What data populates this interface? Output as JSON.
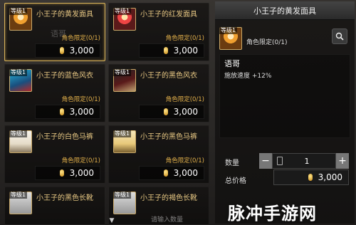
{
  "items": [
    {
      "level": "等级1",
      "name": "小王子的黄发面具",
      "limit": "角色限定(0/1)",
      "price": "3,000",
      "thumb": "gold"
    },
    {
      "level": "等级1",
      "name": "小王子的红发面具",
      "limit": "角色限定(0/1)",
      "price": "3,000",
      "thumb": "red"
    },
    {
      "level": "等级1",
      "name": "小王子的蓝色风衣",
      "limit": "角色限定(0/1)",
      "price": "3,000",
      "thumb": "blue"
    },
    {
      "level": "等级1",
      "name": "小王子的黑色风衣",
      "limit": "角色限定(0/1)",
      "price": "3,000",
      "thumb": "dark"
    },
    {
      "level": "等级1",
      "name": "小王子的白色马裤",
      "limit": "角色限定(0/1)",
      "price": "3,000",
      "thumb": "white"
    },
    {
      "level": "等级1",
      "name": "小王子的黑色马裤",
      "limit": "角色限定(0/1)",
      "price": "3,000",
      "thumb": "cream"
    },
    {
      "level": "等级1",
      "name": "小王子的黑色长靴",
      "limit": "",
      "price": "",
      "thumb": "bw"
    },
    {
      "level": "等级1",
      "name": "小王子的褐色长靴",
      "limit": "",
      "price": "",
      "thumb": "bw"
    }
  ],
  "faint_text": "语哥",
  "detail": {
    "title": "小王子的黄发面具",
    "level": "等级1",
    "limit": "角色限定(0/1)",
    "desc_title": "语哥",
    "desc_stat": "施放速度 +12%",
    "qty_label": "数量",
    "qty_value": "1",
    "minus": "−",
    "plus": "+",
    "total_label": "总价格",
    "total_value": "3,000"
  },
  "bottom_hint": "请输入数量",
  "watermark": "脉冲手游网",
  "icons": {
    "search": "magnifier-icon",
    "coin": "gold-coin-icon",
    "calc": "calculator-icon",
    "scroll": "chevron-down-icon"
  }
}
